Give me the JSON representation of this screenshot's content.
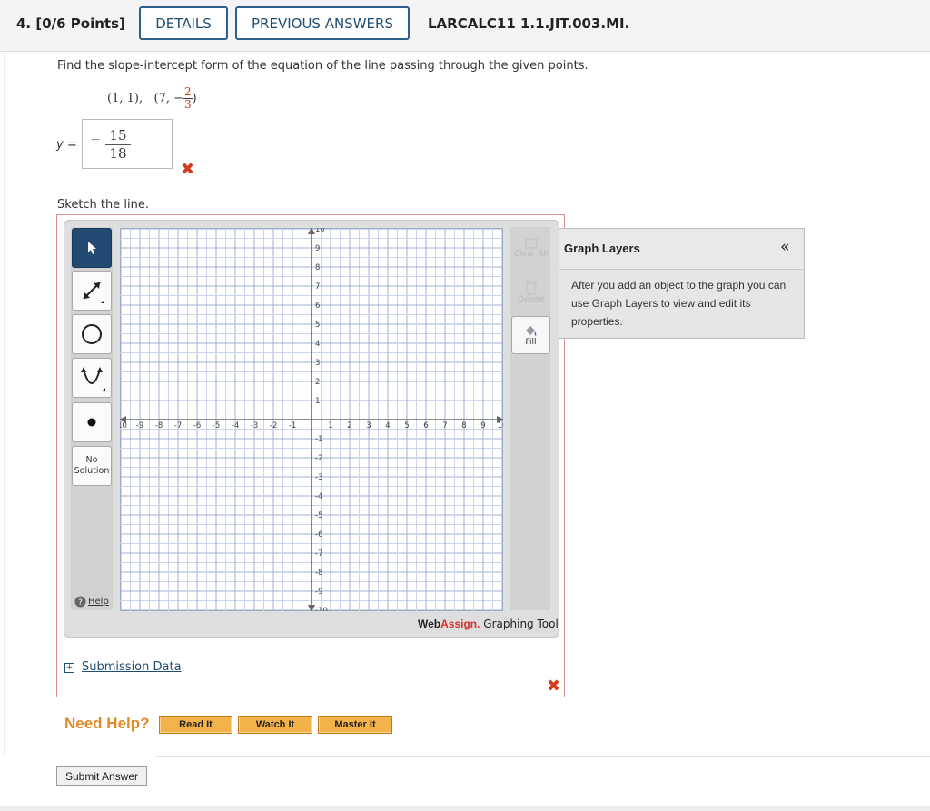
{
  "header": {
    "question_number": "4. [0/6 Points]",
    "details_label": "DETAILS",
    "previous_answers_label": "PREVIOUS ANSWERS",
    "question_code": "LARCALC11 1.1.JIT.003.MI."
  },
  "problem": {
    "prompt": "Find the slope-intercept form of the equation of the line passing through the given points.",
    "point1": "(1, 1),",
    "point2_open": "(7, −",
    "point2_num": "2",
    "point2_den": "3",
    "point2_close": ")"
  },
  "answer": {
    "label": "y =",
    "sign": "−",
    "numerator": "15",
    "denominator": "18",
    "status": "incorrect"
  },
  "sketch_label": "Sketch the line.",
  "graph_tool": {
    "tools": [
      "pointer",
      "line",
      "circle",
      "parabola",
      "point"
    ],
    "no_solution_label": "No Solution",
    "help_label": "Help",
    "clear_all_label": "Clear All",
    "delete_label": "Delete",
    "fill_label": "Fill",
    "brand_web": "Web",
    "brand_assign": "Assign.",
    "brand_suffix": "Graphing Tool",
    "x_ticks": [
      "-10",
      "-9",
      "-8",
      "-7",
      "-6",
      "-5",
      "-4",
      "-3",
      "-2",
      "-1",
      "1",
      "2",
      "3",
      "4",
      "5",
      "6",
      "7",
      "8",
      "9",
      "10"
    ],
    "y_ticks_pos": [
      "10",
      "9",
      "8",
      "7",
      "6",
      "5",
      "4",
      "3",
      "2",
      "1"
    ],
    "y_ticks_neg": [
      "-1",
      "-2",
      "-3",
      "-4",
      "-5",
      "-6",
      "-7",
      "-8",
      "-9",
      "-10"
    ],
    "axis_range": [
      -10,
      10
    ],
    "grid_step": 0.5
  },
  "graph_layers": {
    "title": "Graph Layers",
    "collapse_icon": "«",
    "body": "After you add an object to the graph you can use Graph Layers to view and edit its properties."
  },
  "submission_data_label": "Submission Data",
  "help": {
    "title": "Need Help?",
    "read_it": "Read It",
    "watch_it": "Watch It",
    "master_it": "Master It"
  },
  "submit_label": "Submit Answer",
  "colors": {
    "accent": "#1f4d74",
    "error": "#d13b1e",
    "help_orange": "#f4b24a",
    "brand_red": "#d6322a"
  }
}
